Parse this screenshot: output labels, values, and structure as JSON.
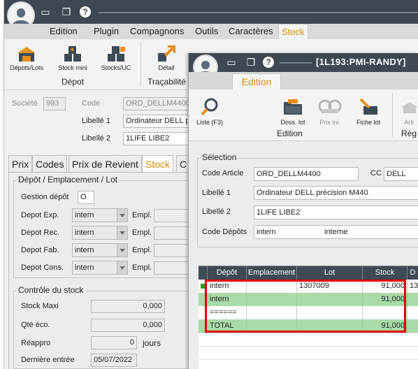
{
  "back": {
    "menu": [
      "Edition",
      "Plugin",
      "Compagnons",
      "Outils",
      "Caractères",
      "Stock"
    ],
    "ribbon": {
      "buttons": [
        {
          "label": "Dépots/Lots",
          "icon": "warehouse-icon"
        },
        {
          "label": "Stock mini",
          "icon": "boxes-icon"
        },
        {
          "label": "Stocks/UC",
          "icon": "boxes-stack-icon"
        },
        {
          "label": "Détail",
          "icon": "arrow-up-right-icon"
        }
      ],
      "groups": [
        "Dépot",
        "Traçabilité"
      ]
    },
    "header": {
      "societe_label": "Société",
      "societe_value": "993",
      "code_label": "Code",
      "code_value": "ORD_DELLM4400",
      "libelle1_label": "Libellé 1",
      "libelle1_value": "Ordinateur DELL pr",
      "libelle2_label": "Libellé 2",
      "libelle2_value": "1LIFE LIBE2"
    },
    "tabs": [
      "Prix",
      "Codes",
      "Prix de Revient",
      "Stock",
      "C"
    ],
    "depot_group": {
      "title": "Dépôt / Emplacement / Lot",
      "gestion_label": "Gestion dépôt",
      "gestion_value": "O",
      "rows": [
        {
          "label": "Depot Exp.",
          "value": "intern",
          "empl_label": "Empl."
        },
        {
          "label": "Depot Rec.",
          "value": "intern",
          "empl_label": "Empl."
        },
        {
          "label": "Depot Fab.",
          "value": "intern",
          "empl_label": "Empl."
        },
        {
          "label": "Depot Cons.",
          "value": "intern",
          "empl_label": "Empl."
        }
      ]
    },
    "controle_group": {
      "title": "Contrôle du stock",
      "stock_maxi_label": "Stock Maxi",
      "stock_maxi_value": "0,000",
      "qte_eco_label": "Qté éco.",
      "qte_eco_value": "0,000",
      "reappro_label": "Réappro",
      "reappro_value": "0",
      "reappro_unit": "jours",
      "derniere_label": "Dernière entrée",
      "derniere_value": "05/07/2022"
    }
  },
  "front": {
    "title": "[1L193:PMI-RANDY]",
    "tab": "Edition",
    "ribbon": {
      "buttons": [
        {
          "label": "Liste (F3)",
          "icon": "magnifier-icon"
        },
        {
          "label": "Doss. lot",
          "icon": "folder-icon"
        },
        {
          "label": "Prix ini.",
          "icon": "price-icon"
        },
        {
          "label": "Fiche lot",
          "icon": "brush-card-icon"
        },
        {
          "label": "Arti",
          "icon": "article-icon"
        }
      ],
      "groups": [
        "Edition",
        "Règ"
      ]
    },
    "selection": {
      "title": "Sélection",
      "code_article_label": "Code Article",
      "code_article_value": "ORD_DELLM4400",
      "cc_label": "CC",
      "cc_value": "DELL",
      "libelle1_label": "Libellé 1",
      "libelle1_value": "Ordinateur DELL précision M440",
      "libelle2_label": "Libellé 2",
      "libelle2_value": "1LIFE LIBE2",
      "code_depots_label": "Code Dépôts",
      "code_depots_value": "intern",
      "code_depots_desc": "interne"
    },
    "grid": {
      "columns": [
        "Dépôt",
        "Emplacement",
        "Lot",
        "Stock",
        "D"
      ],
      "rows": [
        {
          "depot": "intern",
          "emplacement": "",
          "lot": "1307009",
          "stock": "91,000",
          "extra": "13",
          "style": "normal"
        },
        {
          "depot": "intern",
          "emplacement": "",
          "lot": "",
          "stock": "91,000",
          "extra": "",
          "style": "green"
        },
        {
          "depot": "======",
          "emplacement": "",
          "lot": "",
          "stock": "",
          "extra": "",
          "style": "normal"
        },
        {
          "depot": "TOTAL",
          "emplacement": "",
          "lot": "",
          "stock": "91,000",
          "extra": "",
          "style": "green"
        }
      ]
    }
  },
  "colors": {
    "titlebar": "#3d4852",
    "accent_tab": "#d98a00",
    "highlight_row": "#a8dba8",
    "annotation_box": "#e00000"
  }
}
